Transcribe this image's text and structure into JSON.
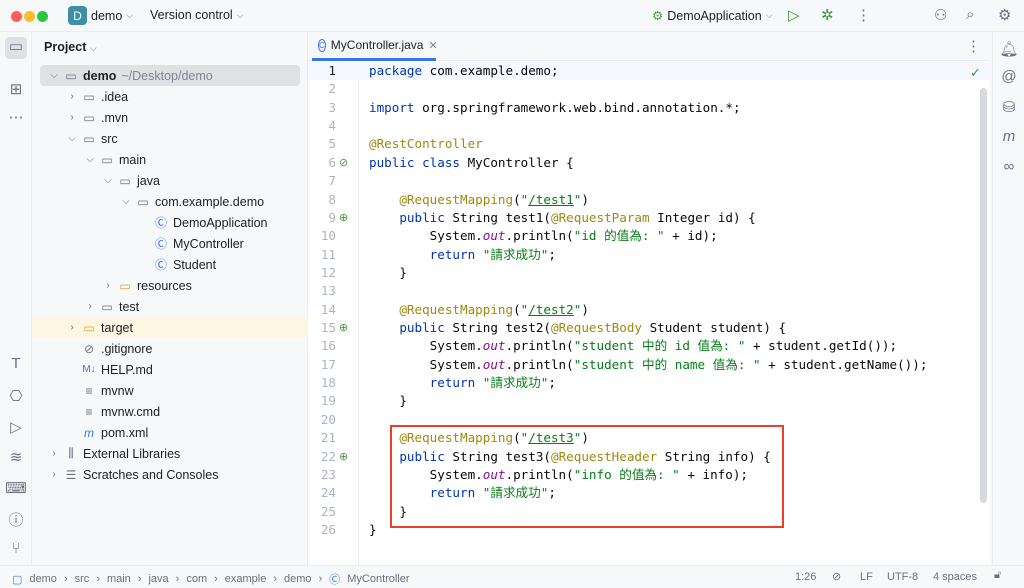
{
  "titlebar": {
    "project_initial": "D",
    "project": "demo",
    "vcs": "Version control",
    "run_config": "DemoApplication"
  },
  "project_panel": {
    "title": "Project",
    "tree": [
      {
        "label": "demo",
        "suffix": "~/Desktop/demo",
        "level": 0,
        "arrow": "down",
        "icon": "module-folder-icon",
        "bold": true,
        "selected": true
      },
      {
        "label": ".idea",
        "level": 1,
        "arrow": "right",
        "icon": "folder-icon"
      },
      {
        "label": ".mvn",
        "level": 1,
        "arrow": "right",
        "icon": "folder-icon"
      },
      {
        "label": "src",
        "level": 1,
        "arrow": "down",
        "icon": "folder-icon"
      },
      {
        "label": "main",
        "level": 2,
        "arrow": "down",
        "icon": "folder-icon"
      },
      {
        "label": "java",
        "level": 3,
        "arrow": "down",
        "icon": "source-folder-icon"
      },
      {
        "label": "com.example.demo",
        "level": 4,
        "arrow": "down",
        "icon": "package-icon"
      },
      {
        "label": "DemoApplication",
        "level": 5,
        "arrow": "",
        "icon": "spring-class-icon"
      },
      {
        "label": "MyController",
        "level": 5,
        "arrow": "",
        "icon": "class-icon"
      },
      {
        "label": "Student",
        "level": 5,
        "arrow": "",
        "icon": "class-icon"
      },
      {
        "label": "resources",
        "level": 3,
        "arrow": "right",
        "icon": "resources-folder-icon"
      },
      {
        "label": "test",
        "level": 2,
        "arrow": "right",
        "icon": "folder-icon"
      },
      {
        "label": "target",
        "level": 1,
        "arrow": "right",
        "icon": "excluded-folder-icon",
        "highlight": true
      },
      {
        "label": ".gitignore",
        "level": 1,
        "arrow": "",
        "icon": "ignore-file-icon"
      },
      {
        "label": "HELP.md",
        "level": 1,
        "arrow": "",
        "icon": "markdown-icon"
      },
      {
        "label": "mvnw",
        "level": 1,
        "arrow": "",
        "icon": "text-file-icon"
      },
      {
        "label": "mvnw.cmd",
        "level": 1,
        "arrow": "",
        "icon": "text-file-icon"
      },
      {
        "label": "pom.xml",
        "level": 1,
        "arrow": "",
        "icon": "maven-icon"
      },
      {
        "label": "External Libraries",
        "level": 0,
        "arrow": "right",
        "icon": "libraries-icon"
      },
      {
        "label": "Scratches and Consoles",
        "level": 0,
        "arrow": "right",
        "icon": "scratches-icon"
      }
    ]
  },
  "editor": {
    "tab": "MyController.java",
    "lines": [
      [
        [
          "kw",
          "package"
        ],
        [
          "pl",
          " com.example.demo;"
        ]
      ],
      [],
      [
        [
          "kw",
          "import"
        ],
        [
          "pl",
          " org.springframework.web.bind.annotation.*;"
        ]
      ],
      [],
      [
        [
          "ann",
          "@RestController"
        ]
      ],
      [
        [
          "kw",
          "public class"
        ],
        [
          "pl",
          " MyController {"
        ]
      ],
      [],
      [
        [
          "pl",
          "    "
        ],
        [
          "ann",
          "@RequestMapping"
        ],
        [
          "pl",
          "("
        ],
        [
          "str",
          "\""
        ],
        [
          "lnk",
          "/test1"
        ],
        [
          "str",
          "\""
        ],
        [
          "pl",
          ")"
        ]
      ],
      [
        [
          "pl",
          "    "
        ],
        [
          "kw",
          "public"
        ],
        [
          "pl",
          " String test1("
        ],
        [
          "ann",
          "@RequestParam"
        ],
        [
          "pl",
          " Integer id) {"
        ]
      ],
      [
        [
          "pl",
          "        System."
        ],
        [
          "it",
          "out"
        ],
        [
          "pl",
          ".println("
        ],
        [
          "str",
          "\"id 的值為: \""
        ],
        [
          "pl",
          " + id);"
        ]
      ],
      [
        [
          "pl",
          "        "
        ],
        [
          "kw",
          "return"
        ],
        [
          "pl",
          " "
        ],
        [
          "str",
          "\"請求成功\""
        ],
        [
          "pl",
          ";"
        ]
      ],
      [
        [
          "pl",
          "    }"
        ]
      ],
      [],
      [
        [
          "pl",
          "    "
        ],
        [
          "ann",
          "@RequestMapping"
        ],
        [
          "pl",
          "("
        ],
        [
          "str",
          "\""
        ],
        [
          "lnk",
          "/test2"
        ],
        [
          "str",
          "\""
        ],
        [
          "pl",
          ")"
        ]
      ],
      [
        [
          "pl",
          "    "
        ],
        [
          "kw",
          "public"
        ],
        [
          "pl",
          " String test2("
        ],
        [
          "ann",
          "@RequestBody"
        ],
        [
          "pl",
          " Student student) {"
        ]
      ],
      [
        [
          "pl",
          "        System."
        ],
        [
          "it",
          "out"
        ],
        [
          "pl",
          ".println("
        ],
        [
          "str",
          "\"student 中的 id 值為: \""
        ],
        [
          "pl",
          " + student.getId());"
        ]
      ],
      [
        [
          "pl",
          "        System."
        ],
        [
          "it",
          "out"
        ],
        [
          "pl",
          ".println("
        ],
        [
          "str",
          "\"student 中的 name 值為: \""
        ],
        [
          "pl",
          " + student.getName());"
        ]
      ],
      [
        [
          "pl",
          "        "
        ],
        [
          "kw",
          "return"
        ],
        [
          "pl",
          " "
        ],
        [
          "str",
          "\"請求成功\""
        ],
        [
          "pl",
          ";"
        ]
      ],
      [
        [
          "pl",
          "    }"
        ]
      ],
      [],
      [
        [
          "pl",
          "    "
        ],
        [
          "ann",
          "@RequestMapping"
        ],
        [
          "pl",
          "("
        ],
        [
          "str",
          "\""
        ],
        [
          "lnk",
          "/test3"
        ],
        [
          "str",
          "\""
        ],
        [
          "pl",
          ")"
        ]
      ],
      [
        [
          "pl",
          "    "
        ],
        [
          "kw",
          "public"
        ],
        [
          "pl",
          " String test3("
        ],
        [
          "ann",
          "@RequestHeader"
        ],
        [
          "pl",
          " String info) {"
        ]
      ],
      [
        [
          "pl",
          "        System."
        ],
        [
          "it",
          "out"
        ],
        [
          "pl",
          ".println("
        ],
        [
          "str",
          "\"info 的值為: \""
        ],
        [
          "pl",
          " + info);"
        ]
      ],
      [
        [
          "pl",
          "        "
        ],
        [
          "kw",
          "return"
        ],
        [
          "pl",
          " "
        ],
        [
          "str",
          "\"請求成功\""
        ],
        [
          "pl",
          ";"
        ]
      ],
      [
        [
          "pl",
          "    }"
        ]
      ],
      [
        [
          "pl",
          "}"
        ]
      ]
    ],
    "gutter_icons": {
      "6": "bean-icon",
      "9": "endpoint-icon",
      "15": "endpoint-icon",
      "22": "endpoint-icon"
    },
    "highlight_color": "#e8402a"
  },
  "statusbar": {
    "breadcrumb": [
      "demo",
      "src",
      "main",
      "java",
      "com",
      "example",
      "demo",
      "MyController"
    ],
    "position": "1:26",
    "line_sep": "LF",
    "encoding": "UTF-8",
    "indent": "4 spaces"
  }
}
